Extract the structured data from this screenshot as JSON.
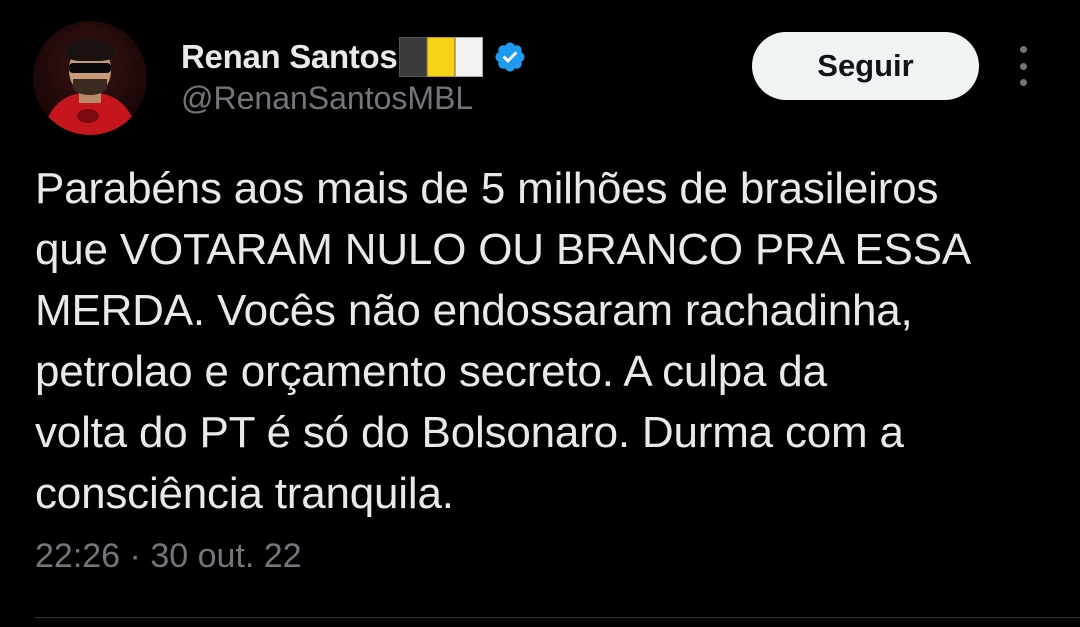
{
  "author": {
    "display_name": "Renan Santos",
    "handle": "@RenanSantosMBL",
    "verified": true,
    "avatar_icon": "avatar-photo",
    "flag_colors": [
      "#3b3b3b",
      "#f7d117",
      "#f2f2f2"
    ]
  },
  "follow_button": {
    "label": "Seguir"
  },
  "tweet": {
    "lines": [
      "Parabéns aos mais de 5 milhões de brasileiros",
      "que VOTARAM NULO OU BRANCO PRA ESSA",
      "MERDA. Vocês não endossaram rachadinha,",
      "petrolao e orçamento secreto. A culpa da",
      "volta do PT é só do Bolsonaro. Durma com a",
      "consciência tranquila."
    ],
    "time": "22:26",
    "separator": "·",
    "date": "30 out. 22"
  },
  "colors": {
    "background": "#000000",
    "text_primary": "#e7e9ea",
    "text_secondary": "#71767b",
    "verified_blue": "#1d9bf0",
    "button_bg": "#eff3f4"
  },
  "icons": {
    "verified": "verified-badge-icon",
    "more": "more-options-icon"
  }
}
